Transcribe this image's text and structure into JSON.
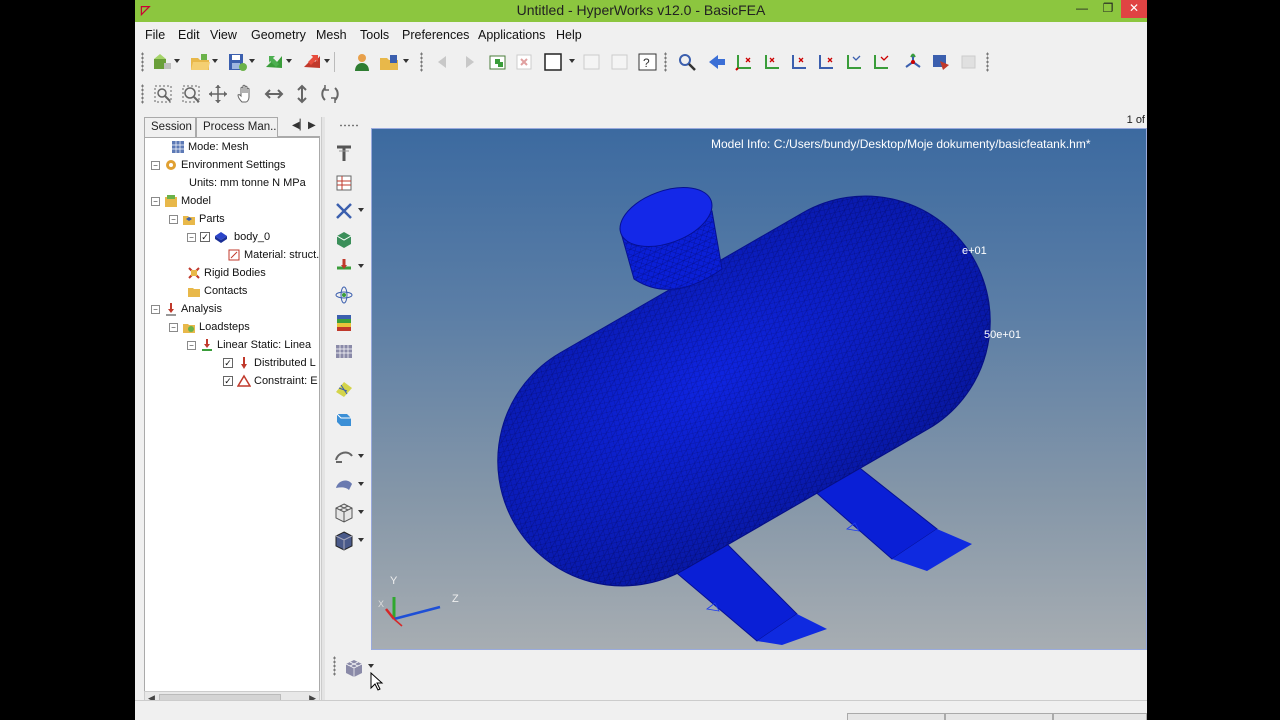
{
  "window": {
    "title": "Untitled - HyperWorks v12.0 - BasicFEA",
    "controls": {
      "minimize": "—",
      "maximize": "❐",
      "close": "✕"
    }
  },
  "menu": [
    "File",
    "Edit",
    "View",
    "Geometry",
    "Mesh",
    "Tools",
    "Preferences",
    "Applications",
    "Help"
  ],
  "page_indicator": "1 of",
  "left_panel": {
    "tabs": [
      "Session",
      "Process Man..."
    ],
    "tree": {
      "mode": "Mode: Mesh",
      "environment": "Environment Settings",
      "units": "Units: mm tonne N MPa",
      "model": "Model",
      "parts": "Parts",
      "part": "body_0",
      "material": "Material: struct...",
      "rigid_bodies": "Rigid Bodies",
      "contacts": "Contacts",
      "analysis": "Analysis",
      "loadsteps": "Loadsteps",
      "loadstep": "Linear Static: Linea",
      "load": "Distributed L",
      "constraint": "Constraint: E"
    }
  },
  "viewport": {
    "model_info": "Model Info: C:/Users/bundy/Desktop/Moje dokumenty/basicfeatank.hm*",
    "legend_1": "e+01",
    "legend_2": "50e+01",
    "axis_x": "X",
    "axis_y": "Y",
    "axis_z": "Z"
  },
  "colors": {
    "titlebar": "#8cc63f",
    "mesh": "#0a1fd6",
    "viewport_top": "#3c6aa0",
    "viewport_bottom": "#a7adb2"
  },
  "icons": {
    "toolbar_row1": [
      "mesh-import-icon",
      "open-folder-icon",
      "save-icon",
      "import-icon",
      "export-icon",
      "user-icon",
      "open-file-icon",
      "undo-icon",
      "redo-icon",
      "new-window-icon",
      "delete-icon",
      "square-icon",
      "box-icon",
      "box2-icon",
      "query-icon",
      "zoom-icon",
      "back-arrow-icon",
      "view-xy-icon",
      "view-yx-icon",
      "view-xz-icon",
      "view-zx-icon",
      "view-yz-icon",
      "view-zy-icon",
      "iso-view-icon",
      "flag-icon",
      "disabled-icon"
    ],
    "toolbar_row2": [
      "zoom-fit-icon",
      "zoom-window-icon",
      "pan-icon",
      "move-icon",
      "rotate-x-icon",
      "rotate-y-icon",
      "rotate-icon"
    ]
  }
}
